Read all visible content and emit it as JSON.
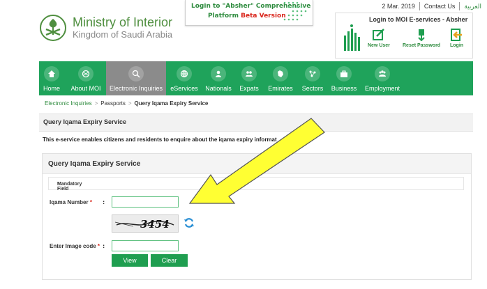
{
  "header": {
    "ministry_title": "Ministry of Interior",
    "ministry_subtitle": "Kingdom of Saudi Arabia",
    "promo_line1": "Login to \"Absher\" Comprehensive",
    "promo_line2_prefix": "Platform",
    "promo_line2_badge": "Beta Version",
    "date": "2 Mar. 2019",
    "contact_us": "Contact Us",
    "arabic_link": "العربية",
    "absher_title": "Login to MOI E-services - Absher",
    "absher_buttons": [
      {
        "label": "New User",
        "icon": "new-user-icon"
      },
      {
        "label": "Reset Password",
        "icon": "reset-password-icon"
      },
      {
        "label": "Login",
        "icon": "login-icon"
      }
    ]
  },
  "nav": {
    "items": [
      {
        "label": "Home",
        "icon": "home-icon"
      },
      {
        "label": "About MOI",
        "icon": "emblem-icon"
      },
      {
        "label": "Electronic Inquiries",
        "icon": "inquiry-icon"
      },
      {
        "label": "eServices",
        "icon": "globe-icon"
      },
      {
        "label": "Nationals",
        "icon": "person-icon"
      },
      {
        "label": "Expats",
        "icon": "group-icon"
      },
      {
        "label": "Emirates",
        "icon": "map-icon"
      },
      {
        "label": "Sectors",
        "icon": "network-icon"
      },
      {
        "label": "Business",
        "icon": "briefcase-icon"
      },
      {
        "label": "Employment",
        "icon": "people-icon"
      }
    ],
    "active_index": 2
  },
  "breadcrumb": {
    "items": [
      "Electronic Inquiries",
      "Passports",
      "Query Iqama Expiry Service"
    ]
  },
  "page": {
    "title": "Query Iqama Expiry Service",
    "description": "This e-service enables citizens and residents to enquire about the iqama expiry informat"
  },
  "form": {
    "title": "Query Iqama Expiry Service",
    "mandatory_note": "Mandatory Field",
    "iqama_label": "Iqama Number",
    "iqama_value": "",
    "captcha_text": "3454",
    "image_code_label": "Enter Image code",
    "image_code_value": "",
    "view_button": "View",
    "clear_button": "Clear",
    "colon": ":",
    "required_mark": "*"
  },
  "colors": {
    "brand_green": "#1fa35b",
    "active_nav": "#8b8b8b",
    "arrow_fill": "#ffff33",
    "required_red": "#d9261c"
  }
}
